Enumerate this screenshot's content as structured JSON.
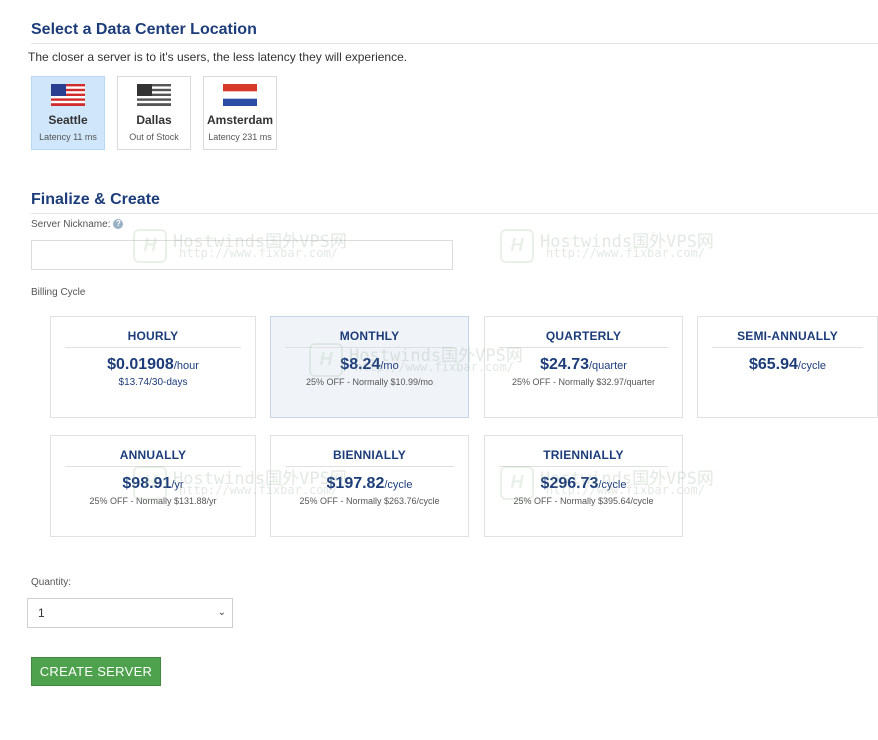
{
  "location_section": {
    "title": "Select a Data Center Location",
    "intro": "The closer a server is to it's users, the less latency they will experience.",
    "locations": [
      {
        "city": "Seattle",
        "status": "Latency 11 ms",
        "flag": "us-flag-icon",
        "selected": true
      },
      {
        "city": "Dallas",
        "status": "Out of Stock",
        "flag": "us-flag-grey-icon",
        "selected": false
      },
      {
        "city": "Amsterdam",
        "status": "Latency 231 ms",
        "flag": "nl-flag-icon",
        "selected": false
      }
    ]
  },
  "finalize_section": {
    "title": "Finalize & Create",
    "nickname_label": "Server Nickname:",
    "nickname_value": "",
    "help_glyph": "?",
    "billing_label": "Billing Cycle",
    "cycles": [
      {
        "name": "HOURLY",
        "amount": "$0.01908",
        "unit": "/hour",
        "note": "$13.74/30-days",
        "selected": false
      },
      {
        "name": "MONTHLY",
        "amount": "$8.24",
        "unit": "/mo",
        "note": "25% OFF - Normally $10.99/mo",
        "selected": true
      },
      {
        "name": "QUARTERLY",
        "amount": "$24.73",
        "unit": "/quarter",
        "note": "25% OFF - Normally $32.97/quarter",
        "selected": false
      },
      {
        "name": "SEMI-ANNUALLY",
        "amount": "$65.94",
        "unit": "/cycle",
        "note": "",
        "selected": false
      },
      {
        "name": "ANNUALLY",
        "amount": "$98.91",
        "unit": "/yr",
        "note": "25% OFF - Normally $131.88/yr",
        "selected": false
      },
      {
        "name": "BIENNIALLY",
        "amount": "$197.82",
        "unit": "/cycle",
        "note": "25% OFF - Normally $263.76/cycle",
        "selected": false
      },
      {
        "name": "TRIENNIALLY",
        "amount": "$296.73",
        "unit": "/cycle",
        "note": "25% OFF - Normally $395.64/cycle",
        "selected": false
      }
    ],
    "quantity_label": "Quantity:",
    "quantity_value": "1",
    "create_button": "CREATE SERVER"
  },
  "watermark": {
    "logo_letter": "H",
    "line1": "Hostwinds国外VPS网",
    "line2": "http://www.fixbar.com/"
  },
  "colors": {
    "heading": "#1d3d7a",
    "selected_location": "#cfe6fb",
    "selected_cycle": "#f0f4f9",
    "create_button": "#4ea24e"
  }
}
